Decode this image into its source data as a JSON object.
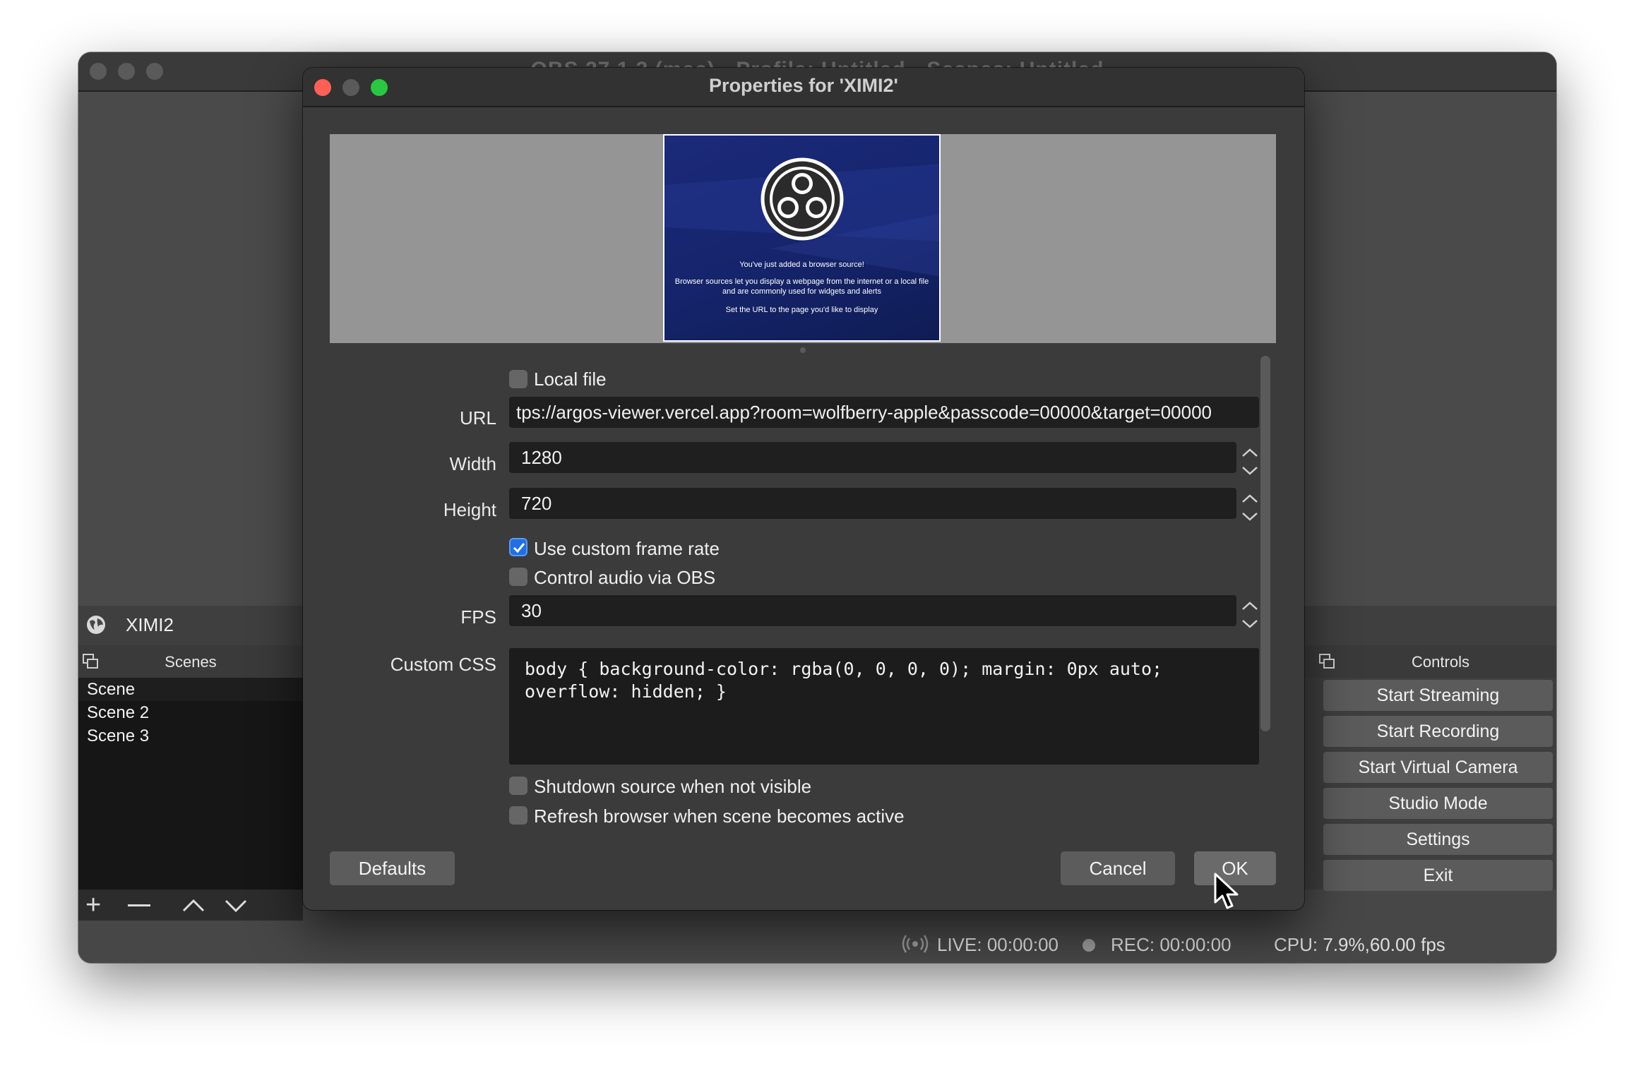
{
  "main_window": {
    "title": "OBS 27.1.3 (mac) - Profile: Untitled - Scenes: Untitled",
    "source_name": "XIMI2",
    "scenes": {
      "title": "Scenes",
      "items": [
        "Scene",
        "Scene 2",
        "Scene 3"
      ]
    },
    "controls": {
      "title": "Controls",
      "buttons": [
        "Start Streaming",
        "Start Recording",
        "Start Virtual Camera",
        "Studio Mode",
        "Settings",
        "Exit"
      ]
    },
    "status": {
      "live": "LIVE: 00:00:00",
      "rec": "REC: 00:00:00",
      "cpu": "CPU: 7.9%,60.00 fps"
    }
  },
  "dialog": {
    "title": "Properties for 'XIMI2'",
    "preview": {
      "line1": "You've just added a browser source!",
      "line2": "Browser sources let you display a webpage from the internet or a local file and are commonly used for widgets and alerts",
      "line3": "Set the URL to the page you'd like to display"
    },
    "local_file_label": "Local file",
    "url_label": "URL",
    "url_value": "tps://argos-viewer.vercel.app?room=wolfberry-apple&passcode=00000&target=00000",
    "width_label": "Width",
    "width_value": "1280",
    "height_label": "Height",
    "height_value": "720",
    "custom_frame_rate_label": "Use custom frame rate",
    "custom_frame_rate_checked": true,
    "control_audio_label": "Control audio via OBS",
    "fps_label": "FPS",
    "fps_value": "30",
    "custom_css_label": "Custom CSS",
    "custom_css_value": "body { background-color: rgba(0, 0, 0, 0); margin: 0px auto;\noverflow: hidden; }",
    "shutdown_label": "Shutdown source when not visible",
    "refresh_label": "Refresh browser when scene becomes active",
    "defaults_button": "Defaults",
    "cancel_button": "Cancel",
    "ok_button": "OK"
  },
  "colors": {
    "accent_blue": "#1f6fe5",
    "close_red": "#fe5f57",
    "zoom_green": "#28c840"
  }
}
